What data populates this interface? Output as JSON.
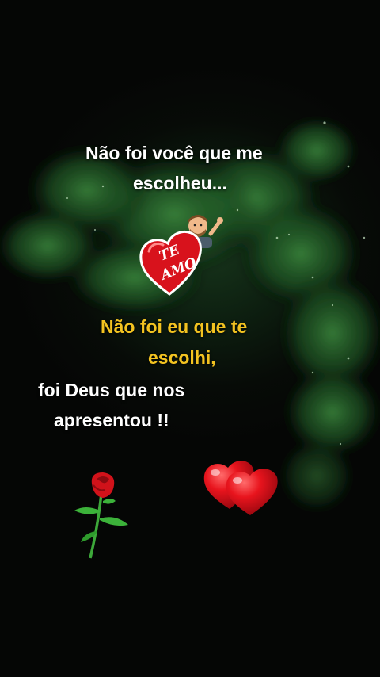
{
  "text": {
    "line1": "Não foi você que me",
    "line2": "escolheu...",
    "line3": "Não foi eu que te",
    "line4": "escolhi,",
    "line5": "foi Deus que nos",
    "line6": "apresentou !!"
  },
  "sticker": {
    "heart_text_1": "TE",
    "heart_text_2": "AMO"
  },
  "colors": {
    "background": "#060806",
    "foliage": "#2f7a35",
    "text_white": "#ffffff",
    "text_yellow": "#f3c320",
    "heart_red": "#e0141e"
  },
  "icons": [
    "tree-foliage",
    "man-emoji-waving-icon",
    "te-amo-heart-icon",
    "red-rose-icon",
    "double-hearts-icon"
  ]
}
